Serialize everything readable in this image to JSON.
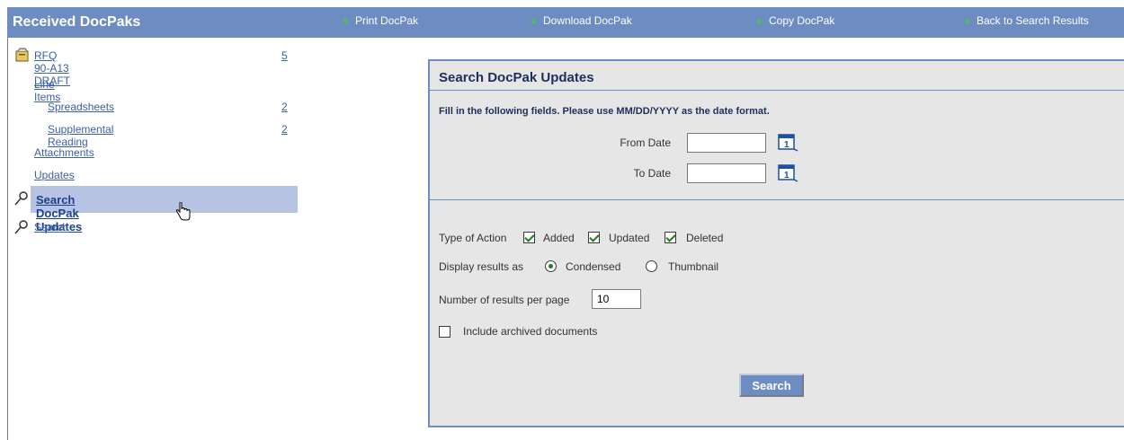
{
  "header": {
    "title": "Received DocPaks",
    "links": [
      "Print DocPak",
      "Download DocPak",
      "Copy DocPak",
      "Back to Search Results"
    ]
  },
  "sidebar": {
    "root": {
      "label": "RFQ 90-A13 DRAFT",
      "count": "5"
    },
    "items": [
      {
        "label": "Line Items"
      },
      {
        "label": "Spreadsheets",
        "count": "2"
      },
      {
        "label": "Supplemental Reading",
        "count": "2"
      },
      {
        "label": "Attachments"
      },
      {
        "label": "Updates"
      },
      {
        "label": "Search DocPak Updates"
      },
      {
        "label": "Search"
      }
    ]
  },
  "panel": {
    "title": "Search DocPak Updates",
    "instructions": "Fill in the following fields. Please use MM/DD/YYYY as the date format.",
    "from_date_label": "From Date",
    "to_date_label": "To Date",
    "from_date_value": "",
    "to_date_value": "",
    "type_of_action_label": "Type of Action",
    "actions": [
      {
        "label": "Added",
        "checked": true
      },
      {
        "label": "Updated",
        "checked": true
      },
      {
        "label": "Deleted",
        "checked": true
      }
    ],
    "display_label": "Display results as",
    "display_options": [
      {
        "label": "Condensed",
        "selected": true
      },
      {
        "label": "Thumbnail",
        "selected": false
      }
    ],
    "results_per_page_label": "Number of results per page",
    "results_per_page_value": "10",
    "include_archived_label": "Include archived documents",
    "include_archived_checked": false,
    "search_button": "Search"
  }
}
